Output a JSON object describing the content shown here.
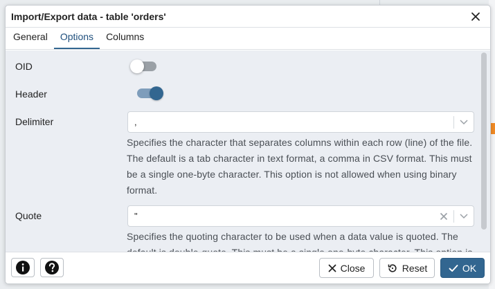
{
  "dialog": {
    "title": "Import/Export data - table 'orders'"
  },
  "tabs": [
    {
      "label": "General",
      "active": false
    },
    {
      "label": "Options",
      "active": true
    },
    {
      "label": "Columns",
      "active": false
    }
  ],
  "options": {
    "oid": {
      "label": "OID",
      "enabled": false
    },
    "header": {
      "label": "Header",
      "enabled": true
    },
    "delimiter": {
      "label": "Delimiter",
      "value": ",",
      "help": "Specifies the character that separates columns within each row (line) of the file. The default is a tab character in text format, a comma in CSV format. This must be a single one-byte character. This option is not allowed when using binary format."
    },
    "quote": {
      "label": "Quote",
      "value": "\"",
      "help": "Specifies the quoting character to be used when a data value is quoted. The default is double-quote. This must be a single one-byte character. This option is allowed only when using CSV format."
    }
  },
  "footer": {
    "info_icon": "info-icon",
    "help_icon": "question-icon",
    "close_label": "Close",
    "reset_label": "Reset",
    "ok_label": "OK"
  },
  "colors": {
    "accent": "#326690",
    "content_bg": "#ebeef3"
  }
}
